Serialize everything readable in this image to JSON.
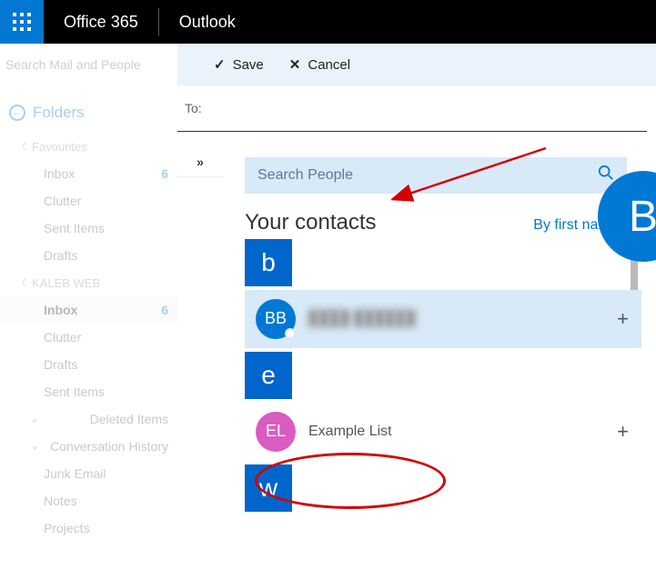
{
  "topbar": {
    "brand1": "Office 365",
    "brand2": "Outlook"
  },
  "search": {
    "placeholder": "Search Mail and People"
  },
  "actions": {
    "save": "Save",
    "cancel": "Cancel"
  },
  "folders": {
    "title": "Folders",
    "groups": [
      {
        "label": "Favourites",
        "items": [
          {
            "label": "Inbox",
            "badge": "6"
          },
          {
            "label": "Clutter"
          },
          {
            "label": "Sent Items"
          },
          {
            "label": "Drafts"
          }
        ]
      },
      {
        "label": "KALEB WEB",
        "items": [
          {
            "label": "Inbox",
            "badge": "6",
            "selected": true
          },
          {
            "label": "Clutter"
          },
          {
            "label": "Drafts"
          },
          {
            "label": "Sent Items"
          },
          {
            "label": "Deleted Items",
            "caret": true
          },
          {
            "label": "Conversation History",
            "caret": true
          },
          {
            "label": "Junk Email"
          },
          {
            "label": "Notes"
          },
          {
            "label": "Projects"
          }
        ]
      }
    ]
  },
  "compose": {
    "to_label": "To:"
  },
  "people": {
    "search_placeholder": "Search People",
    "heading": "Your contacts",
    "sort": "By first name",
    "big_avatar": "B",
    "sections": [
      {
        "letter": "b",
        "contacts": [
          {
            "initials": "BB",
            "name": "████ ██████",
            "redacted": true,
            "color": "blue",
            "highlight": true,
            "presence": true
          }
        ]
      },
      {
        "letter": "e",
        "contacts": [
          {
            "initials": "EL",
            "name": "Example List",
            "color": "pink",
            "circled": true
          }
        ]
      },
      {
        "letter": "w",
        "contacts": []
      }
    ]
  }
}
